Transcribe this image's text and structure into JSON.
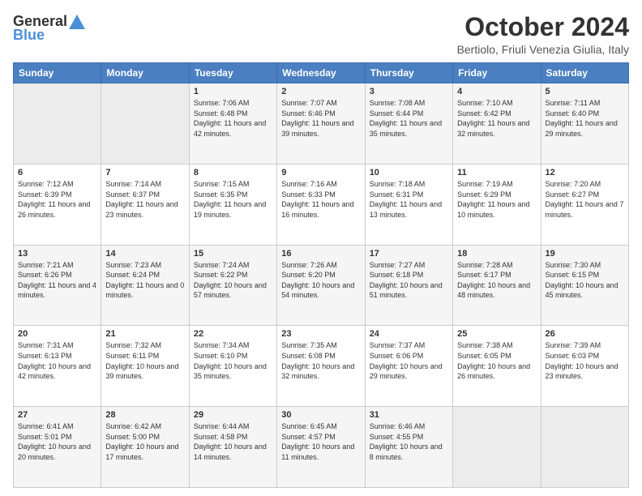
{
  "header": {
    "logo_general": "General",
    "logo_blue": "Blue",
    "title": "October 2024",
    "subtitle": "Bertiolo, Friuli Venezia Giulia, Italy"
  },
  "weekdays": [
    "Sunday",
    "Monday",
    "Tuesday",
    "Wednesday",
    "Thursday",
    "Friday",
    "Saturday"
  ],
  "weeks": [
    [
      null,
      null,
      {
        "day": "1",
        "sunrise": "7:06 AM",
        "sunset": "6:48 PM",
        "daylight": "11 hours and 42 minutes."
      },
      {
        "day": "2",
        "sunrise": "7:07 AM",
        "sunset": "6:46 PM",
        "daylight": "11 hours and 39 minutes."
      },
      {
        "day": "3",
        "sunrise": "7:08 AM",
        "sunset": "6:44 PM",
        "daylight": "11 hours and 35 minutes."
      },
      {
        "day": "4",
        "sunrise": "7:10 AM",
        "sunset": "6:42 PM",
        "daylight": "11 hours and 32 minutes."
      },
      {
        "day": "5",
        "sunrise": "7:11 AM",
        "sunset": "6:40 PM",
        "daylight": "11 hours and 29 minutes."
      }
    ],
    [
      {
        "day": "6",
        "sunrise": "7:12 AM",
        "sunset": "6:39 PM",
        "daylight": "11 hours and 26 minutes."
      },
      {
        "day": "7",
        "sunrise": "7:14 AM",
        "sunset": "6:37 PM",
        "daylight": "11 hours and 23 minutes."
      },
      {
        "day": "8",
        "sunrise": "7:15 AM",
        "sunset": "6:35 PM",
        "daylight": "11 hours and 19 minutes."
      },
      {
        "day": "9",
        "sunrise": "7:16 AM",
        "sunset": "6:33 PM",
        "daylight": "11 hours and 16 minutes."
      },
      {
        "day": "10",
        "sunrise": "7:18 AM",
        "sunset": "6:31 PM",
        "daylight": "11 hours and 13 minutes."
      },
      {
        "day": "11",
        "sunrise": "7:19 AM",
        "sunset": "6:29 PM",
        "daylight": "11 hours and 10 minutes."
      },
      {
        "day": "12",
        "sunrise": "7:20 AM",
        "sunset": "6:27 PM",
        "daylight": "11 hours and 7 minutes."
      }
    ],
    [
      {
        "day": "13",
        "sunrise": "7:21 AM",
        "sunset": "6:26 PM",
        "daylight": "11 hours and 4 minutes."
      },
      {
        "day": "14",
        "sunrise": "7:23 AM",
        "sunset": "6:24 PM",
        "daylight": "11 hours and 0 minutes."
      },
      {
        "day": "15",
        "sunrise": "7:24 AM",
        "sunset": "6:22 PM",
        "daylight": "10 hours and 57 minutes."
      },
      {
        "day": "16",
        "sunrise": "7:26 AM",
        "sunset": "6:20 PM",
        "daylight": "10 hours and 54 minutes."
      },
      {
        "day": "17",
        "sunrise": "7:27 AM",
        "sunset": "6:18 PM",
        "daylight": "10 hours and 51 minutes."
      },
      {
        "day": "18",
        "sunrise": "7:28 AM",
        "sunset": "6:17 PM",
        "daylight": "10 hours and 48 minutes."
      },
      {
        "day": "19",
        "sunrise": "7:30 AM",
        "sunset": "6:15 PM",
        "daylight": "10 hours and 45 minutes."
      }
    ],
    [
      {
        "day": "20",
        "sunrise": "7:31 AM",
        "sunset": "6:13 PM",
        "daylight": "10 hours and 42 minutes."
      },
      {
        "day": "21",
        "sunrise": "7:32 AM",
        "sunset": "6:11 PM",
        "daylight": "10 hours and 39 minutes."
      },
      {
        "day": "22",
        "sunrise": "7:34 AM",
        "sunset": "6:10 PM",
        "daylight": "10 hours and 35 minutes."
      },
      {
        "day": "23",
        "sunrise": "7:35 AM",
        "sunset": "6:08 PM",
        "daylight": "10 hours and 32 minutes."
      },
      {
        "day": "24",
        "sunrise": "7:37 AM",
        "sunset": "6:06 PM",
        "daylight": "10 hours and 29 minutes."
      },
      {
        "day": "25",
        "sunrise": "7:38 AM",
        "sunset": "6:05 PM",
        "daylight": "10 hours and 26 minutes."
      },
      {
        "day": "26",
        "sunrise": "7:39 AM",
        "sunset": "6:03 PM",
        "daylight": "10 hours and 23 minutes."
      }
    ],
    [
      {
        "day": "27",
        "sunrise": "6:41 AM",
        "sunset": "5:01 PM",
        "daylight": "10 hours and 20 minutes."
      },
      {
        "day": "28",
        "sunrise": "6:42 AM",
        "sunset": "5:00 PM",
        "daylight": "10 hours and 17 minutes."
      },
      {
        "day": "29",
        "sunrise": "6:44 AM",
        "sunset": "4:58 PM",
        "daylight": "10 hours and 14 minutes."
      },
      {
        "day": "30",
        "sunrise": "6:45 AM",
        "sunset": "4:57 PM",
        "daylight": "10 hours and 11 minutes."
      },
      {
        "day": "31",
        "sunrise": "6:46 AM",
        "sunset": "4:55 PM",
        "daylight": "10 hours and 8 minutes."
      },
      null,
      null
    ]
  ]
}
